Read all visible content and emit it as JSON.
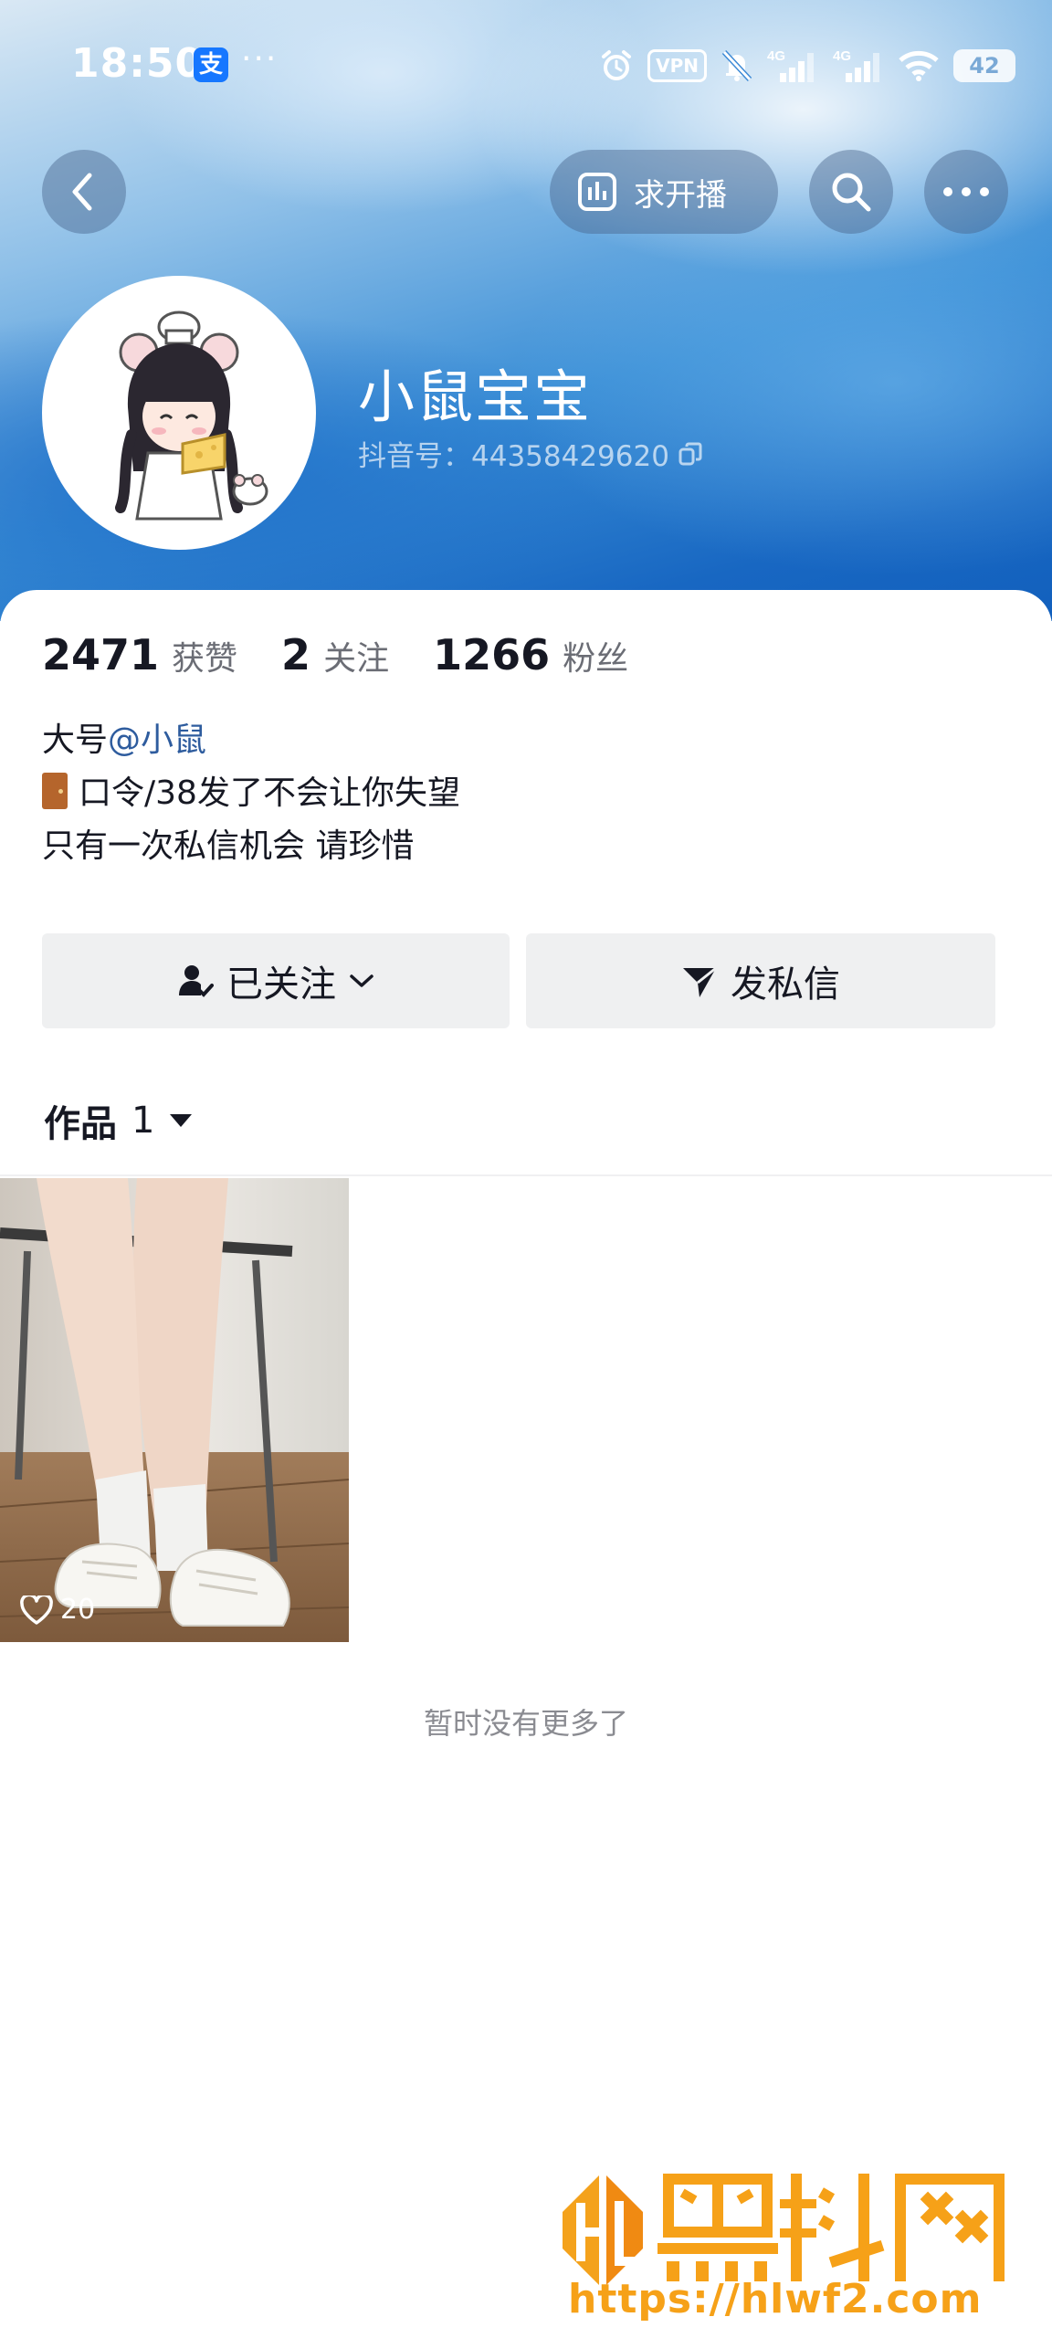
{
  "status_bar": {
    "time": "18:50",
    "alipay_glyph": "支",
    "more": "···",
    "vpn": "VPN",
    "net1": "4G",
    "net2": "4G",
    "battery": "42"
  },
  "nav": {
    "request_live_label": "求开播"
  },
  "profile": {
    "name": "小鼠宝宝",
    "douyin_id": "抖音号：44358429620"
  },
  "stats": {
    "likes_count": "2471",
    "likes_label": "获赞",
    "following_count": "2",
    "following_label": "关注",
    "followers_count": "1266",
    "followers_label": "粉丝"
  },
  "bio": {
    "line1_prefix": "大号",
    "line1_mention": "@小鼠",
    "line2": "口令/38发了不会让你失望",
    "line3": "只有一次私信机会 请珍惜"
  },
  "actions": {
    "followed_label": "已关注",
    "message_label": "发私信"
  },
  "works": {
    "tab_label": "作品",
    "tab_count": "1",
    "items": [
      {
        "likes": "20"
      }
    ],
    "end_text": "暂时没有更多了"
  },
  "watermark": {
    "title": "黑料网",
    "url": "https://hlwf2.com"
  }
}
